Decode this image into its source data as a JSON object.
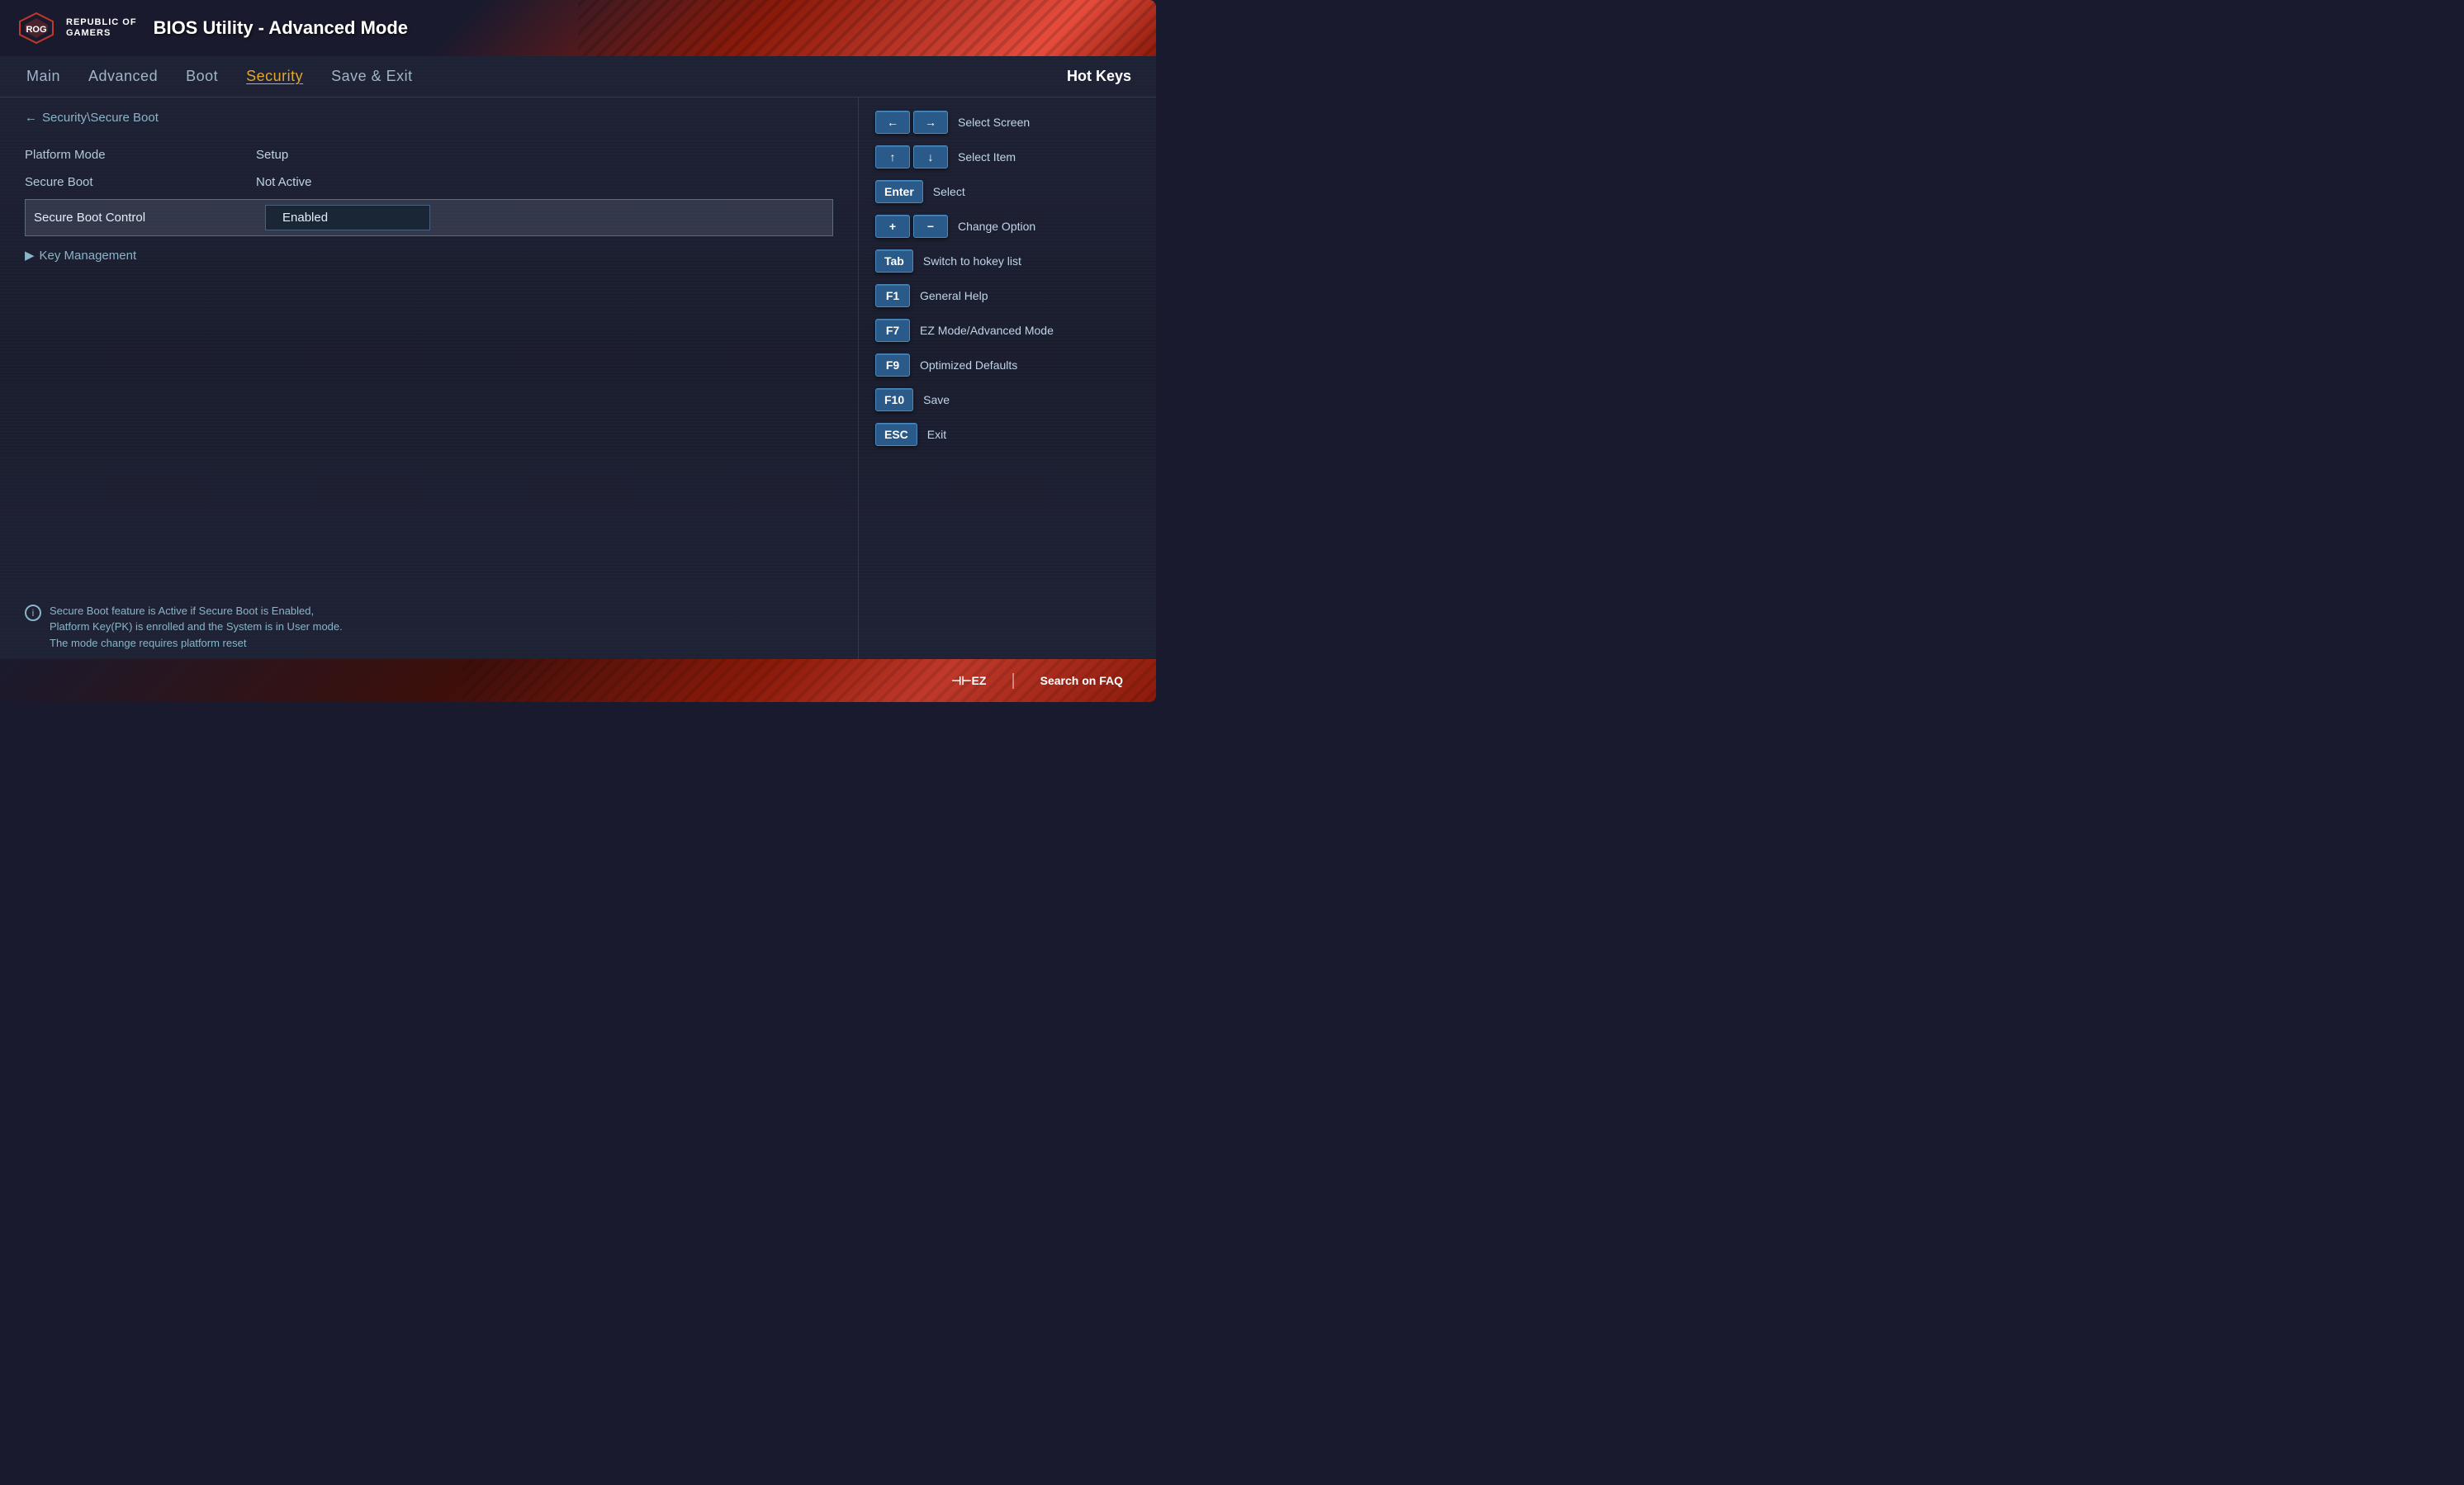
{
  "header": {
    "logo_line1": "REPUBLIC OF",
    "logo_line2": "GAMERS",
    "title": "BIOS Utility - Advanced Mode"
  },
  "nav": {
    "items": [
      {
        "id": "main",
        "label": "Main",
        "active": false
      },
      {
        "id": "advanced",
        "label": "Advanced",
        "active": false
      },
      {
        "id": "boot",
        "label": "Boot",
        "active": false
      },
      {
        "id": "security",
        "label": "Security",
        "active": true
      },
      {
        "id": "save-exit",
        "label": "Save & Exit",
        "active": false
      }
    ],
    "hotkeys_label": "Hot Keys"
  },
  "breadcrumb": {
    "arrow": "←",
    "path": "Security\\Secure Boot"
  },
  "settings": {
    "rows": [
      {
        "label": "Platform Mode",
        "value": "Setup"
      },
      {
        "label": "Secure Boot",
        "value": "Not Active"
      }
    ],
    "highlighted_row": {
      "label": "Secure Boot Control",
      "value": "Enabled"
    },
    "key_management": {
      "arrow": "▶",
      "label": "Key Management"
    }
  },
  "info": {
    "icon": "i",
    "text": "Secure Boot feature is Active if Secure Boot is Enabled,\nPlatform Key(PK) is enrolled and the System is in User mode.\nThe mode change requires platform reset"
  },
  "hotkeys": {
    "groups": [
      {
        "buttons": [
          "←",
          "→"
        ],
        "description": "Select Screen"
      },
      {
        "buttons": [
          "↑",
          "↓"
        ],
        "description": "Select Item"
      },
      {
        "buttons": [
          "Enter"
        ],
        "description": "Select"
      },
      {
        "buttons": [
          "+",
          "−"
        ],
        "description": "Change Option"
      },
      {
        "buttons": [
          "Tab"
        ],
        "description": "Switch to hokey list"
      },
      {
        "buttons": [
          "F1"
        ],
        "description": "General Help"
      },
      {
        "buttons": [
          "F7"
        ],
        "description": "EZ Mode/Advanced Mode"
      },
      {
        "buttons": [
          "F9"
        ],
        "description": "Optimized Defaults"
      },
      {
        "buttons": [
          "F10"
        ],
        "description": "Save"
      },
      {
        "buttons": [
          "ESC"
        ],
        "description": "Exit"
      }
    ]
  },
  "footer": {
    "ez_mode": "⊣⊢EZ",
    "divider": "|",
    "search_faq": "Search on FAQ"
  }
}
